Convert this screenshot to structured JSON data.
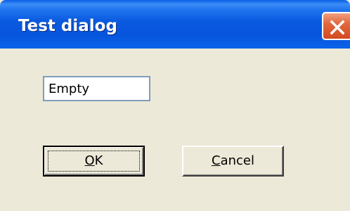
{
  "window": {
    "title": "Test dialog",
    "close_icon": "close-x-icon"
  },
  "form": {
    "text_value": "Empty"
  },
  "buttons": {
    "ok": {
      "mnemonic": "O",
      "rest": "K"
    },
    "cancel": {
      "mnemonic": "C",
      "rest": "ancel"
    }
  },
  "colors": {
    "titlebar": "#0a5ae0",
    "close_button": "#e2683d",
    "dialog_background": "#ece9d8"
  }
}
